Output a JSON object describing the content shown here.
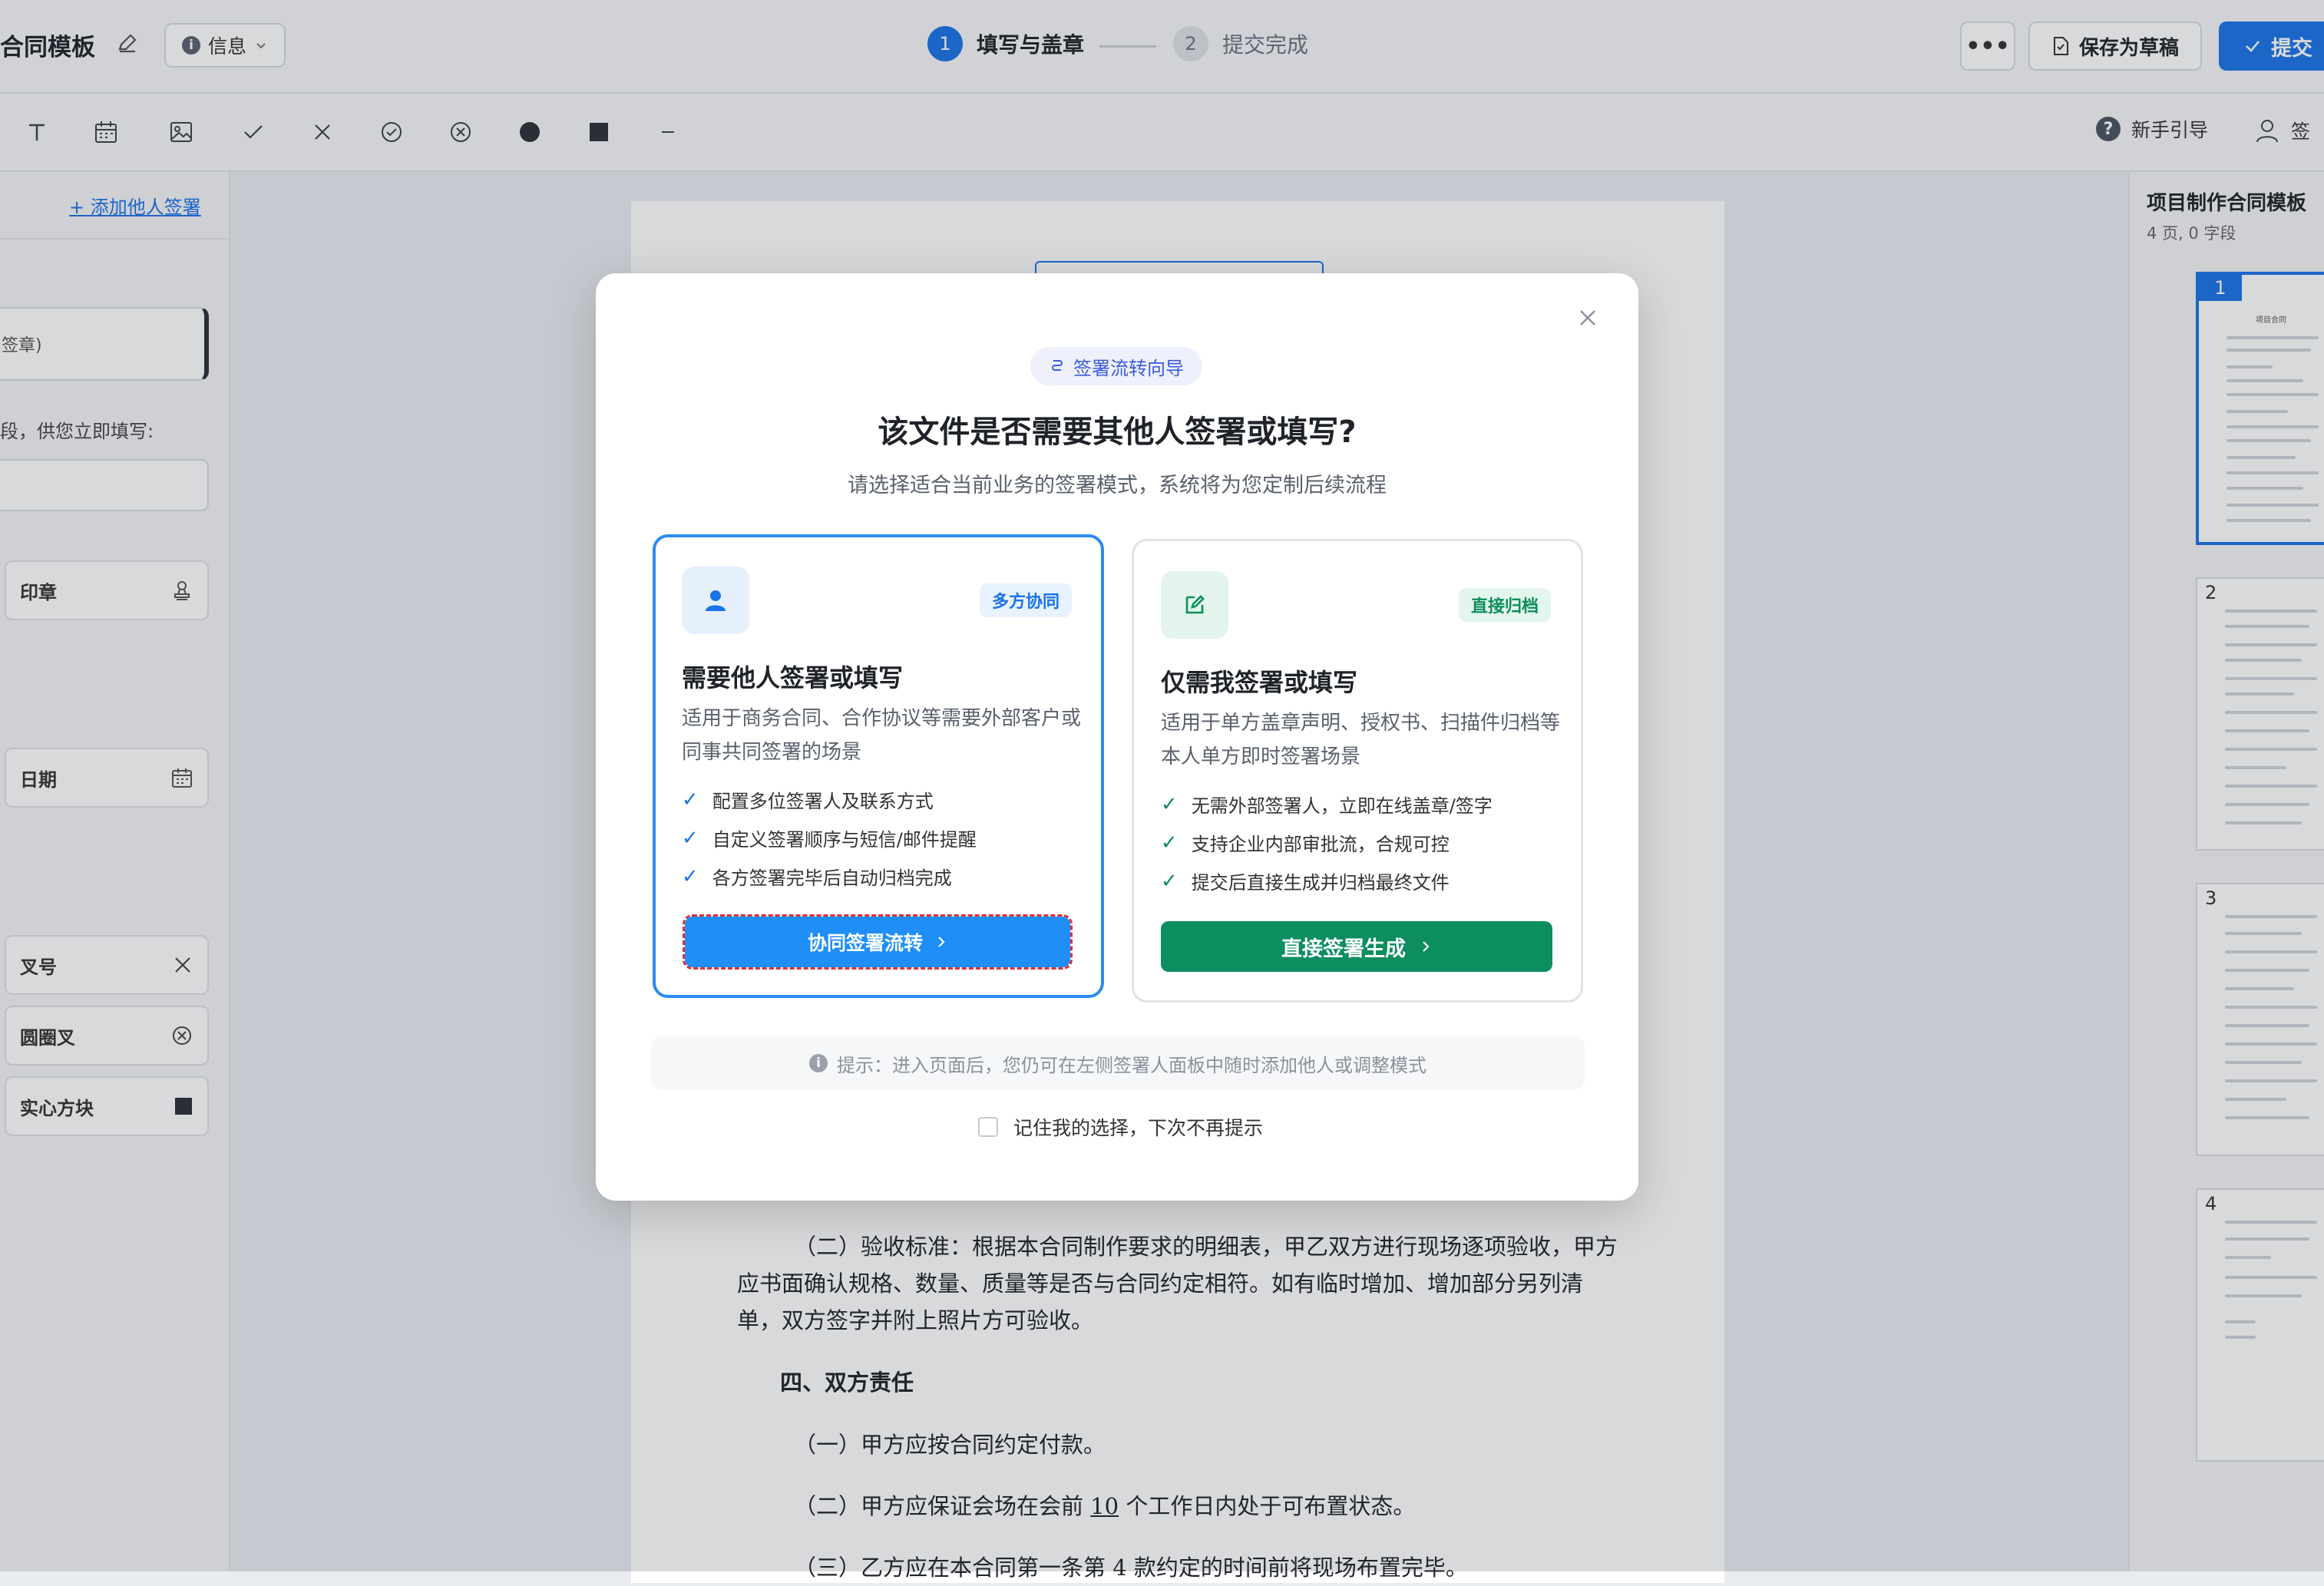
{
  "header": {
    "title": "合同模板",
    "info_label": "信息",
    "steps": [
      {
        "num": "1",
        "label": "填写与盖章"
      },
      {
        "num": "2",
        "label": "提交完成"
      }
    ],
    "more_label": "•••",
    "draft_label": "保存为草稿",
    "submit_label": "提交",
    "accent_color": "#1a73e8"
  },
  "toolbar": {
    "tools": [
      "text-tool",
      "date-tool",
      "image-tool",
      "check-tool",
      "cross-tool",
      "circle-check-tool",
      "circle-cross-tool",
      "dot-tool",
      "square-tool",
      "line-tool"
    ],
    "guide_label": "新手引导",
    "signer_label": "签"
  },
  "left_panel": {
    "add_signer": "+ 添加他人签署",
    "signer_card_text": "签章)",
    "fill_hint": "段，供您立即填写:",
    "fields": [
      {
        "label": "印章",
        "icon": "stamp-icon"
      },
      {
        "label": "日期",
        "icon": "calendar-icon"
      },
      {
        "label": "叉号",
        "icon": "x-icon"
      },
      {
        "label": "圆圈叉",
        "icon": "circle-x-icon"
      },
      {
        "label": "实心方块",
        "icon": "square-icon"
      }
    ]
  },
  "document": {
    "paragraph_1": "（二）验收标准：根据本合同制作要求的明细表，甲乙双方进行现场逐项验收，甲方应书面确认规格、数量、质量等是否与合同约定相符。如有临时增加、增加部分另列清单，双方签字并附上照片方可验收。",
    "heading_4": "四、双方责任",
    "item_1": "（一）甲方应按合同约定付款。",
    "item_2_prefix": "（二）甲方应保证会场在会前 ",
    "item_2_num": "10",
    "item_2_suffix": " 个工作日内处于可布置状态。",
    "item_3": "（三）乙方应在本合同第一条第 4 款约定的时间前将现场布置完毕。"
  },
  "right_panel": {
    "title": "项目制作合同模板",
    "subtitle": "4 页, 0 字段",
    "pages": [
      "1",
      "2",
      "3",
      "4"
    ],
    "thumb_title": "项目合同"
  },
  "modal": {
    "badge": "签署流转向导",
    "title": "该文件是否需要其他人签署或填写?",
    "subtitle": "请选择适合当前业务的签署模式，系统将为您定制后续流程",
    "options": [
      {
        "tag": "多方协同",
        "title": "需要他人签署或填写",
        "desc": "适用于商务合同、合作协议等需要外部客户或同事共同签署的场景",
        "features": [
          "配置多位签署人及联系方式",
          "自定义签署顺序与短信/邮件提醒",
          "各方签署完毕后自动归档完成"
        ],
        "cta": "协同签署流转",
        "color": "#1f8ff7"
      },
      {
        "tag": "直接归档",
        "title": "仅需我签署或填写",
        "desc": "适用于单方盖章声明、授权书、扫描件归档等本人单方即时签署场景",
        "features": [
          "无需外部签署人，立即在线盖章/签字",
          "支持企业内部审批流，合规可控",
          "提交后直接生成并归档最终文件"
        ],
        "cta": "直接签署生成",
        "color": "#0c8e5f"
      }
    ],
    "tip": "提示：进入页面后，您仍可在左侧签署人面板中随时添加他人或调整模式",
    "remember": "记住我的选择，下次不再提示"
  }
}
